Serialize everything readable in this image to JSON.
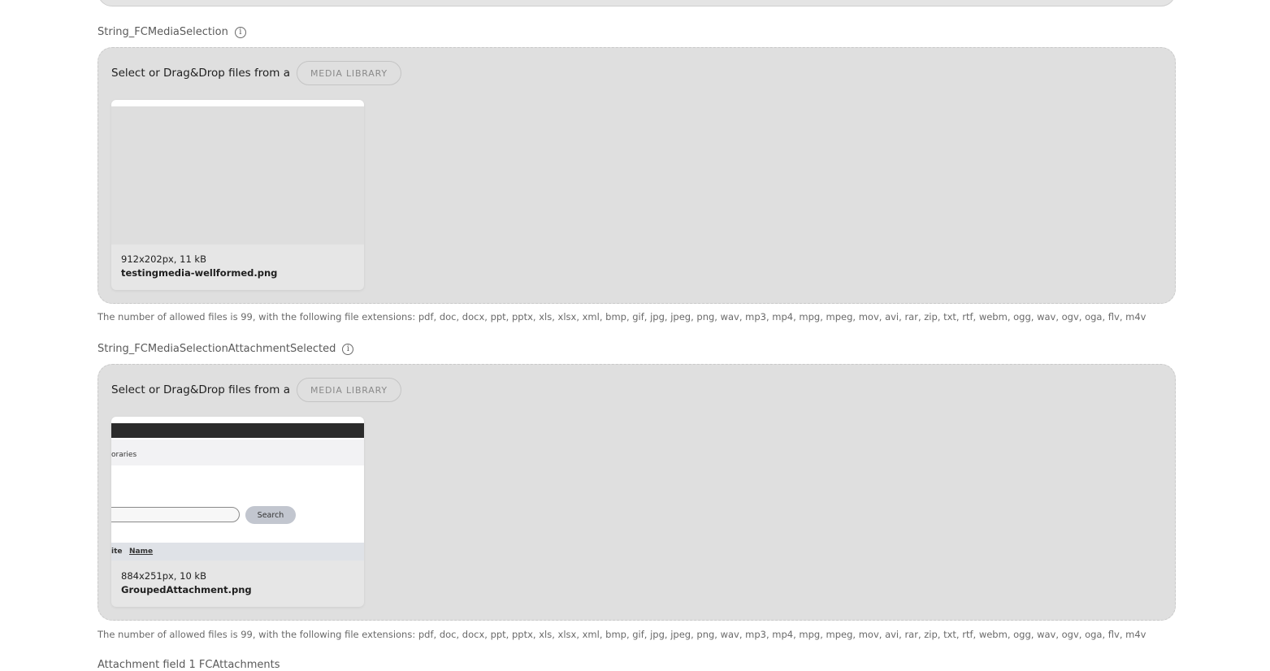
{
  "fields": [
    {
      "label": "String_FCMediaSelection",
      "header_text": "Select or Drag&Drop files from a",
      "button_label": "MEDIA LIBRARY",
      "file": {
        "dimensions": "912x202px, 11 kB",
        "name": "testingmedia-wellformed.png"
      },
      "helper": "The number of allowed files is 99, with the following file extensions: pdf, doc, docx, ppt, pptx, xls, xlsx, xml, bmp, gif, jpg, jpeg, png, wav, mp3, mp4, mpg, mpeg, mov, avi, rar, zip, txt, rtf, webm, ogg, wav, ogv, oga, flv, m4v"
    },
    {
      "label": "String_FCMediaSelectionAttachmentSelected",
      "header_text": "Select or Drag&Drop files from a",
      "button_label": "MEDIA LIBRARY",
      "file": {
        "dimensions": "884x251px, 10 kB",
        "name": "GroupedAttachment.png",
        "thumbnail": {
          "nav_text": "oraries",
          "search_button": "Search",
          "col1": "ite",
          "col2": "Name"
        }
      },
      "helper": "The number of allowed files is 99, with the following file extensions: pdf, doc, docx, ppt, pptx, xls, xlsx, xml, bmp, gif, jpg, jpeg, png, wav, mp3, mp4, mpg, mpeg, mov, avi, rar, zip, txt, rtf, webm, ogg, wav, ogv, oga, flv, m4v"
    }
  ],
  "next_field_label": "Attachment field 1 FCAttachments",
  "icons": {
    "info": "info-icon"
  }
}
